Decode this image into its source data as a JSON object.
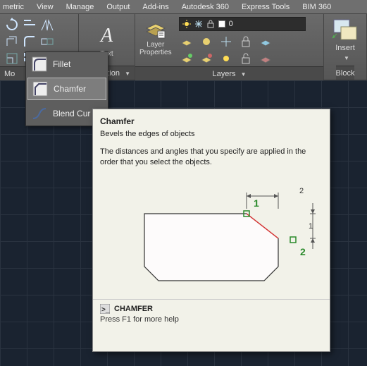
{
  "menubar": {
    "items": [
      "metric",
      "View",
      "Manage",
      "Output",
      "Add-ins",
      "Autodesk 360",
      "Express Tools",
      "BIM 360"
    ]
  },
  "ribbon": {
    "modify_panel": {
      "title_fragment": "Mo",
      "dropdown_fragment": "tion",
      "arrow": "▼"
    },
    "text_panel": {
      "letter": "A",
      "label_fragment": "Text",
      "arrow": "▼"
    },
    "layer_panel": {
      "properties_label": "Layer Properties",
      "dropdown_value": "0",
      "title": "Layers",
      "arrow": "▼"
    },
    "insert_panel": {
      "label": "Insert",
      "arrow": "▼",
      "title": "Block"
    }
  },
  "flyout": {
    "items": [
      {
        "label": "Fillet",
        "icon": "fillet-icon"
      },
      {
        "label": "Chamfer",
        "icon": "chamfer-icon",
        "selected": true
      },
      {
        "label": "Blend Cur",
        "icon": "blend-curves-icon"
      }
    ]
  },
  "tooltip": {
    "title": "Chamfer",
    "summary": "Bevels the edges of objects",
    "description": "The distances and angles that you specify are applied in the order that you select the objects.",
    "diagram": {
      "label1": "1",
      "label2": "2",
      "dim_top": "2",
      "dim_side": "1"
    },
    "footer": {
      "command": "CHAMFER",
      "hint": "Press F1 for more help"
    }
  },
  "icons": {
    "sun": "sun-icon",
    "freeze": "freeze-icon",
    "lock": "lock-icon",
    "swatch": "color-swatch"
  }
}
